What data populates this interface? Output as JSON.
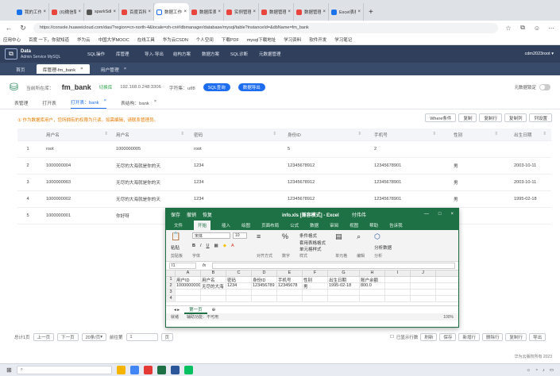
{
  "browser": {
    "tabs": [
      {
        "label": "我的工作台",
        "color": "#1a73e8"
      },
      {
        "label": "(6)微信聊天",
        "color": "#e8453c"
      },
      {
        "label": "sparkSdk",
        "color": "#555555"
      },
      {
        "label": "百度百科",
        "color": "#e8453c"
      },
      {
        "label": "数据工作台",
        "color": "#ffffff",
        "active": true
      },
      {
        "label": "数据库表",
        "color": "#e8453c"
      },
      {
        "label": "实例管理",
        "color": "#e8453c"
      },
      {
        "label": "数据管理",
        "color": "#e8453c"
      },
      {
        "label": "数据管理",
        "color": "#e8453c"
      },
      {
        "label": "Excel表格",
        "color": "#1a73e8"
      }
    ],
    "new_tab": "+",
    "url": "https://console.huaweicloud.com/das/?region=cn-north-4&locale=zh-cn#/dbmanager/database/mysql/table?instanceId=&dbName=fm_bank",
    "bookmarks": [
      "应用中心",
      "百度 一下，你就知道",
      "华为云",
      "中国大学MOOC",
      "在线工具",
      "华为云CSDN",
      "个人空间",
      "下载PDF",
      "mysql下载地址",
      "学习资料",
      "软件开发",
      "学习笔记"
    ]
  },
  "app": {
    "logo_line1": "Data",
    "logo_line2": "Admin Service",
    "engine": "MySQL",
    "menu": [
      "SQL操作",
      "库管理",
      "导入·导出",
      "结构方案",
      "数据方案",
      "SQL诊断",
      "元数据管理"
    ],
    "user": "cdm2023root"
  },
  "page_tabs": [
    {
      "label": "首页",
      "active": false
    },
    {
      "label": "库管理-fm_bank",
      "active": true,
      "close": "×"
    },
    {
      "label": "用户管理",
      "active": false,
      "close": "×"
    }
  ],
  "db": {
    "current_label": "当前所在库：",
    "name": "fm_bank",
    "switch": "切换库",
    "ip": "192.168.0.248:3306",
    "charset_label": "字符集：",
    "charset": "utf8",
    "btn_sql": "SQL查询",
    "btn_export": "数据导出",
    "lock_label": "元数据锁定"
  },
  "sub_tabs": [
    {
      "label": "表管理",
      "active": false
    },
    {
      "label": "打开表",
      "active": false
    },
    {
      "label": "打开表：bank",
      "active": true,
      "close": "×"
    },
    {
      "label": "表结构：bank",
      "active": false,
      "close": "×"
    }
  ],
  "notice": "① 作为数据库用户，您所拥有的权限为只读。如需编辑，请联系管理员。",
  "actions": [
    "Where条件",
    "复制",
    "复制行",
    "复制列",
    "列设置"
  ],
  "table": {
    "columns": [
      "",
      "用户名",
      "用户名",
      "密码",
      "身份ID",
      "手机号",
      "性别",
      "出生日期"
    ],
    "rows": [
      [
        "1",
        "root",
        "1000000005",
        "root",
        "5",
        "2",
        "",
        ""
      ],
      [
        "2",
        "1000000004",
        "无尽的大海就是你的天",
        "1234",
        "12345678912",
        "12345678901",
        "男",
        "2003-10-11"
      ],
      [
        "3",
        "1000000003",
        "无尽的大海就是你的天",
        "1234",
        "12345678912",
        "12345678901",
        "男",
        "2003-10-11"
      ],
      [
        "4",
        "1000000002",
        "无尽的大海就是你的天",
        "1234",
        "12345678912",
        "12345678901",
        "男",
        "1995-02-18"
      ],
      [
        "5",
        "1000000001",
        "你好呀",
        "",
        "",
        "",
        "",
        ""
      ]
    ]
  },
  "bottom": {
    "total": "总计1页",
    "prev": "上一页",
    "next": "下一页",
    "page_size": "20条/页",
    "goto_label": "前往第",
    "page": "1",
    "page_suffix": "页",
    "right_buttons": [
      "刷新",
      "保存",
      "新增行",
      "删除行",
      "复制行",
      "导出"
    ],
    "checkbox_label": "已显示行数"
  },
  "footer": "华为云版权所有 2023",
  "excel": {
    "quick_access": [
      "保存",
      "撤销",
      "恢复"
    ],
    "filename": "info.xls [兼容模式] - Excel",
    "user": "付伟伟",
    "window_controls": [
      "—",
      "□",
      "×"
    ],
    "ribbon_tabs": [
      "文件",
      "开始",
      "插入",
      "绘图",
      "页面布局",
      "公式",
      "数据",
      "审阅",
      "视图",
      "帮助",
      "告诉我"
    ],
    "active_tab": "开始",
    "groups": {
      "clipboard": {
        "paste": "粘贴",
        "label": "剪贴板"
      },
      "font": {
        "name": "宋体",
        "size": "10",
        "bold": "B",
        "italic": "I",
        "underline": "U",
        "label": "字体"
      },
      "align": {
        "label": "对齐方式"
      },
      "number": {
        "label": "数字"
      },
      "styles": {
        "a": "条件格式",
        "b": "套用表格格式",
        "c": "单元格样式",
        "label": "样式"
      },
      "cells": {
        "label": "单元格"
      },
      "edit": {
        "label": "编辑"
      },
      "analyze": {
        "a": "分析数据",
        "label": "分析"
      }
    },
    "namebox": "I1",
    "fx": "fx",
    "col_headers": [
      "",
      "A",
      "B",
      "C",
      "D",
      "E",
      "F",
      "G",
      "H",
      "I",
      "J"
    ],
    "rows": [
      [
        "1",
        "用户ID",
        "用户名",
        "密码",
        "身份ID",
        "手机号",
        "性别",
        "出生日期",
        "账户余额",
        "",
        ""
      ],
      [
        "2",
        "1000000000",
        "无尽的大海",
        "1234",
        "123456789",
        "12345678",
        "男",
        "1995-02-18",
        "800.0",
        "",
        ""
      ],
      [
        "3",
        "",
        "",
        "",
        "",
        "",
        "",
        "",
        "",
        "",
        ""
      ],
      [
        "4",
        "",
        "",
        "",
        "",
        "",
        "",
        "",
        "",
        "",
        ""
      ]
    ],
    "sheet": "第一页",
    "add_sheet": "⊕",
    "status_left": "就绪",
    "status_mid": "辅助功能：不可用",
    "zoom": "100%"
  }
}
